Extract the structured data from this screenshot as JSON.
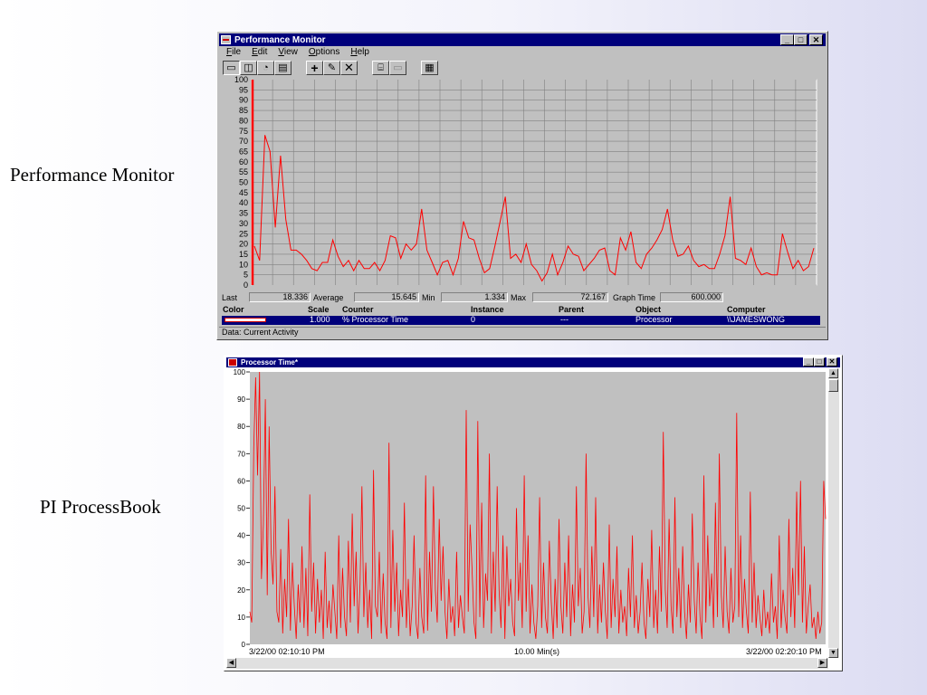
{
  "labels": {
    "perfmon": "Performance Monitor",
    "processbook": "PI ProcessBook"
  },
  "perfmon": {
    "title": "Performance Monitor",
    "menu": [
      "File",
      "Edit",
      "View",
      "Options",
      "Help"
    ],
    "window_buttons": [
      "_",
      "□",
      "✕"
    ],
    "toolbar_icons": [
      "chart-view-icon",
      "alert-view-icon",
      "log-view-icon",
      "report-view-icon",
      "add-counter-icon",
      "edit-counter-icon",
      "delete-counter-icon",
      "snapshot-icon",
      "bookmark-icon",
      "options-icon"
    ],
    "stats": {
      "last_label": "Last",
      "last": "18.336",
      "avg_label": "Average",
      "avg": "15.645",
      "min_label": "Min",
      "min": "1.334",
      "max_label": "Max",
      "max": "72.167",
      "gt_label": "Graph Time",
      "graph_time": "600.000"
    },
    "legend": {
      "headers": {
        "color": "Color",
        "scale": "Scale",
        "counter": "Counter",
        "instance": "Instance",
        "parent": "Parent",
        "object": "Object",
        "computer": "Computer"
      },
      "row": {
        "scale": "1.000",
        "counter": "% Processor Time",
        "instance": "0",
        "parent": "---",
        "object": "Processor",
        "computer": "\\\\JAMESWONG"
      }
    },
    "status": "Data: Current Activity"
  },
  "processbook": {
    "title": "Processor Time*",
    "window_buttons": [
      "_",
      "□",
      "✕"
    ],
    "x_start": "3/22/00 02:10:10 PM",
    "x_span": "10.00 Min(s)",
    "x_end": "3/22/00 02:20:10 PM"
  },
  "chart_data": [
    {
      "type": "line",
      "ylim": [
        0,
        100
      ],
      "yticks": [
        0,
        5,
        10,
        15,
        20,
        25,
        30,
        35,
        40,
        45,
        50,
        55,
        60,
        65,
        70,
        75,
        80,
        85,
        90,
        95,
        100
      ],
      "grid": true,
      "color": "#ff0000",
      "y": [
        19,
        12,
        73,
        65,
        28,
        63,
        32,
        17,
        17,
        15,
        12,
        8,
        7,
        11,
        11,
        22,
        14,
        9,
        12,
        7,
        12,
        8,
        8,
        11,
        7,
        12,
        24,
        23,
        13,
        20,
        17,
        20,
        37,
        17,
        11,
        5,
        11,
        12,
        5,
        13,
        31,
        23,
        22,
        13,
        6,
        8,
        19,
        31,
        43,
        13,
        15,
        11,
        20,
        10,
        7,
        2,
        6,
        15,
        5,
        11,
        19,
        15,
        14,
        7,
        10,
        13,
        17,
        18,
        7,
        5,
        23,
        17,
        26,
        11,
        8,
        15,
        18,
        22,
        27,
        37,
        22,
        14,
        15,
        19,
        12,
        9,
        10,
        8,
        8,
        15,
        24,
        43,
        13,
        12,
        10,
        18,
        9,
        5,
        6,
        5,
        5,
        25,
        16,
        8,
        12,
        7,
        9,
        18
      ]
    },
    {
      "type": "line",
      "ylim": [
        0,
        100
      ],
      "yticks": [
        0,
        10,
        20,
        30,
        40,
        50,
        60,
        70,
        80,
        90,
        100
      ],
      "x_start": "3/22/00 02:10:10 PM",
      "x_end": "3/22/00 02:20:10 PM",
      "color": "#ff0000",
      "y": [
        12,
        8,
        72,
        98,
        62,
        100,
        24,
        44,
        90,
        18,
        80,
        34,
        22,
        58,
        12,
        8,
        35,
        4,
        24,
        10,
        46,
        5,
        30,
        14,
        2,
        22,
        8,
        36,
        6,
        28,
        3,
        55,
        12,
        30,
        4,
        24,
        8,
        20,
        2,
        34,
        6,
        16,
        4,
        22,
        12,
        2,
        40,
        6,
        28,
        10,
        3,
        38,
        8,
        48,
        14,
        34,
        4,
        22,
        58,
        10,
        30,
        6,
        20,
        2,
        64,
        14,
        10,
        34,
        4,
        26,
        8,
        2,
        74,
        6,
        42,
        12,
        30,
        3,
        20,
        10,
        52,
        6,
        24,
        3,
        14,
        40,
        8,
        2,
        28,
        10,
        4,
        62,
        5,
        34,
        12,
        58,
        20,
        8,
        46,
        16,
        36,
        12,
        2,
        24,
        8,
        14,
        3,
        34,
        6,
        18,
        10,
        4,
        86,
        12,
        44,
        28,
        8,
        2,
        82,
        10,
        52,
        6,
        26,
        16,
        70,
        4,
        34,
        12,
        58,
        20,
        6,
        40,
        2,
        36,
        14,
        24,
        8,
        3,
        50,
        16,
        30,
        6,
        62,
        12,
        40,
        4,
        22,
        8,
        2,
        14,
        54,
        6,
        30,
        10,
        4,
        38,
        16,
        2,
        24,
        6,
        46,
        14,
        4,
        30,
        10,
        40,
        3,
        22,
        8,
        58,
        14,
        28,
        4,
        12,
        70,
        18,
        6,
        36,
        10,
        54,
        4,
        22,
        8,
        30,
        12,
        2,
        44,
        6,
        24,
        10,
        36,
        4,
        20,
        8,
        14,
        3,
        28,
        10,
        40,
        6,
        18,
        4,
        12,
        30,
        8,
        2,
        24,
        10,
        42,
        6,
        20,
        4,
        36,
        12,
        78,
        20,
        6,
        46,
        14,
        4,
        54,
        10,
        28,
        6,
        36,
        12,
        2,
        22,
        8,
        48,
        16,
        4,
        30,
        10,
        2,
        62,
        8,
        40,
        14,
        26,
        6,
        52,
        10,
        70,
        18,
        6,
        36,
        12,
        4,
        28,
        8,
        14,
        85,
        10,
        40,
        6,
        24,
        12,
        4,
        56,
        8,
        30,
        6,
        18,
        10,
        3,
        20,
        6,
        12,
        4,
        26,
        8,
        14,
        2,
        40,
        6,
        20,
        10,
        4,
        46,
        10,
        28,
        6,
        56,
        18,
        60,
        8,
        36,
        4,
        14,
        22,
        6,
        10,
        2,
        12,
        4,
        8,
        60,
        46
      ]
    }
  ]
}
